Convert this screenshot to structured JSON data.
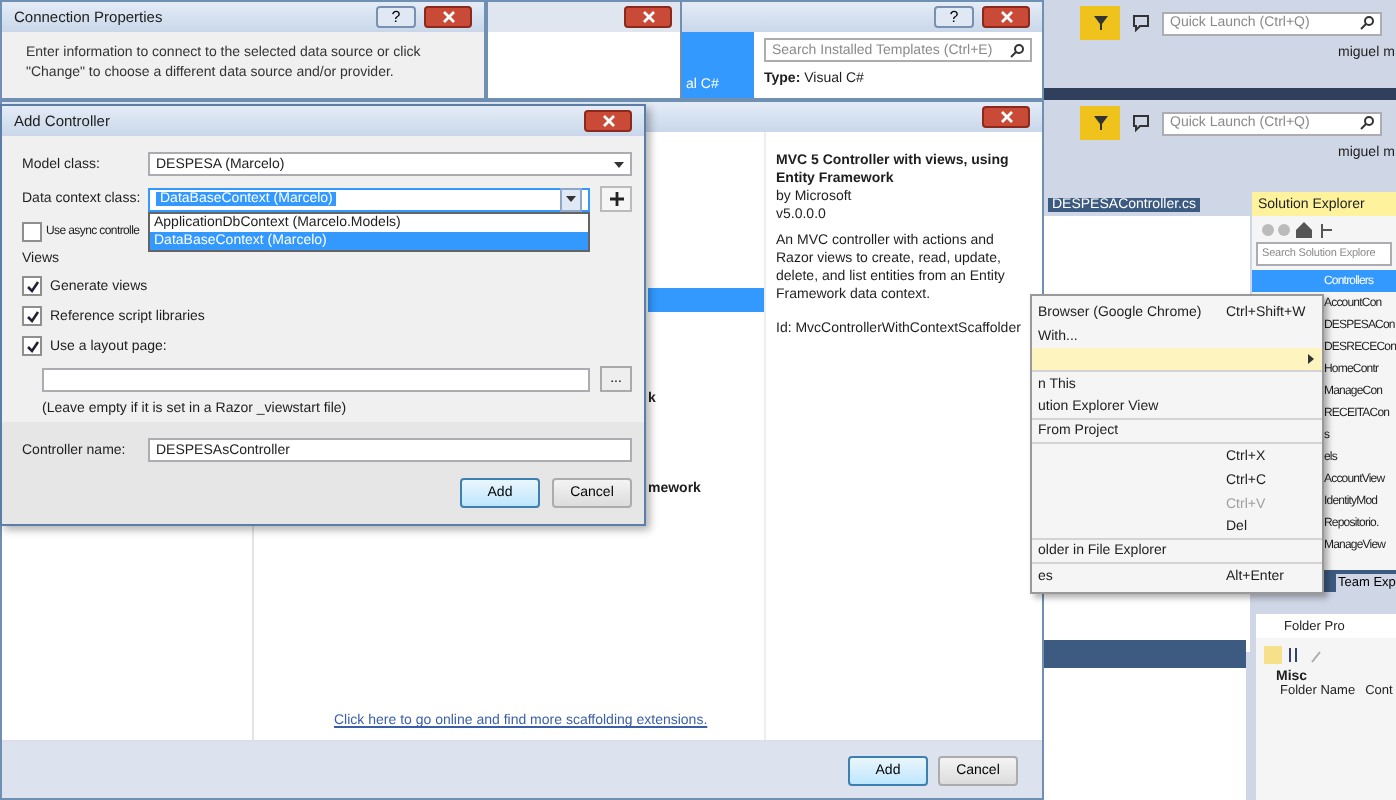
{
  "connection_properties": {
    "title": "Connection Properties",
    "help": "?",
    "description": "Enter information to connect to the selected data source or click \"Change\" to choose a different data source and/or provider."
  },
  "template_window": {
    "help": "?",
    "search": {
      "placeholder": "Search Installed Templates (Ctrl+E)"
    },
    "category_fragment": "al C#",
    "type_label": "Type:",
    "type_value": "Visual C#"
  },
  "add_scaffold": {
    "list_fragments": [
      "k",
      "mework"
    ],
    "detail": {
      "title": "MVC 5 Controller with views, using Entity Framework",
      "author": "by Microsoft",
      "version": "v5.0.0.0",
      "description": "An MVC controller with actions and Razor views to create, read, update, delete, and list entities from an Entity Framework data context.",
      "id": "Id: MvcControllerWithContextScaffolder"
    },
    "link": "Click here to go online and find more scaffolding extensions.",
    "buttons": [
      {
        "label": "Add",
        "default": true
      },
      {
        "label": "Cancel",
        "default": false
      }
    ]
  },
  "add_controller": {
    "title": "Add Controller",
    "model_class": {
      "label": "Model class:",
      "value": "DESPESA (Marcelo)"
    },
    "data_context": {
      "label": "Data context class:",
      "value": "DataBaseContext (Marcelo)",
      "options": [
        {
          "label": "ApplicationDbContext (Marcelo.Models)",
          "selected": false
        },
        {
          "label": "DataBaseContext (Marcelo)",
          "selected": true
        }
      ]
    },
    "async": {
      "label": "Use async controlle",
      "checked": false
    },
    "views_label": "Views",
    "checkboxes": [
      {
        "label": "Generate views",
        "checked": true
      },
      {
        "label": "Reference script libraries",
        "checked": true
      },
      {
        "label": "Use a layout page:",
        "checked": true
      }
    ],
    "browse": "...",
    "hint": "(Leave empty if it is set in a Razor _viewstart file)",
    "controller_name": {
      "label": "Controller name:",
      "value": "DESPESAsController"
    },
    "buttons": [
      {
        "label": "Add",
        "default": true
      },
      {
        "label": "Cancel",
        "default": false
      }
    ]
  },
  "ide": {
    "quick_launch": [
      {
        "placeholder": "Quick Launch (Ctrl+Q)"
      },
      {
        "placeholder": "Quick Launch (Ctrl+Q)"
      }
    ],
    "user": [
      "miguel m",
      "miguel m"
    ],
    "editor_tab": "DESPESAController.cs",
    "context_menu": [
      {
        "label": "Browser (Google Chrome)",
        "shortcut": "Ctrl+Shift+W",
        "highlighted": false,
        "disabled": false,
        "submenu": false,
        "separator_after": false
      },
      {
        "label": "With...",
        "highlighted": false,
        "disabled": false,
        "submenu": false,
        "separator_after": false
      },
      {
        "highlighted": true,
        "disabled": false,
        "submenu": true,
        "separator_after": true
      },
      {
        "label": "n This",
        "highlighted": false,
        "disabled": false,
        "submenu": false,
        "separator_after": false
      },
      {
        "label": "ution Explorer View",
        "highlighted": false,
        "disabled": false,
        "submenu": false,
        "separator_after": true
      },
      {
        "label": "From Project",
        "highlighted": false,
        "disabled": false,
        "submenu": false,
        "separator_after": true
      },
      {
        "shortcut": "Ctrl+X",
        "highlighted": false,
        "disabled": false,
        "submenu": false,
        "separator_after": false
      },
      {
        "shortcut": "Ctrl+C",
        "highlighted": false,
        "disabled": false,
        "submenu": false,
        "separator_after": false
      },
      {
        "shortcut": "Ctrl+V",
        "highlighted": false,
        "disabled": true,
        "submenu": false,
        "separator_after": false
      },
      {
        "shortcut": "Del",
        "highlighted": false,
        "disabled": false,
        "submenu": false,
        "separator_after": true
      },
      {
        "label": "older in File Explorer",
        "highlighted": false,
        "disabled": false,
        "submenu": false,
        "separator_after": true
      },
      {
        "label": "es",
        "shortcut": "Alt+Enter",
        "highlighted": false,
        "disabled": false,
        "submenu": false,
        "separator_after": false
      }
    ],
    "solution_explorer": {
      "title": "Solution Explorer",
      "search": {
        "placeholder": "Search Solution Explore"
      },
      "tree": [
        {
          "label": "Controllers",
          "selected": true,
          "children": [
            {
              "label": "AccountCon",
              "selected": false
            },
            {
              "label": "DESPESACon",
              "selected": false
            },
            {
              "label": "DESRECECon",
              "selected": false
            },
            {
              "label": "HomeContr",
              "selected": false
            },
            {
              "label": "ManageCon",
              "selected": false
            },
            {
              "label": "RECEITACon",
              "selected": false
            }
          ]
        },
        {
          "label": "s",
          "selected": false
        },
        {
          "label": "els",
          "selected": false,
          "children": [
            {
              "label": "AccountView",
              "selected": false
            },
            {
              "label": "IdentityMod",
              "selected": false
            },
            {
              "label": "Repositorio.",
              "selected": false
            },
            {
              "label": "ManageView",
              "selected": false
            }
          ]
        }
      ],
      "tabs": [
        {
          "label": "Team Exp",
          "selected": false
        }
      ]
    },
    "properties": {
      "object_type": "Folder Pro",
      "category": "Misc",
      "rows": [
        {
          "name": "Folder Name",
          "value": "Cont"
        }
      ]
    }
  }
}
